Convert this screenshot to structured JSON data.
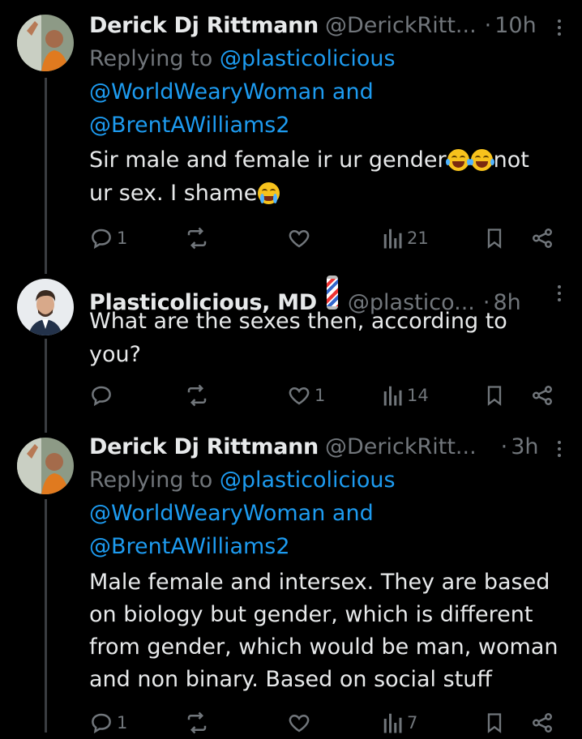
{
  "tweets": [
    {
      "name": "Derick Dj Rittmann",
      "handle": "@DerickRitt...",
      "time": "10h",
      "replying_prefix": "Replying to",
      "replying_1": "@plasticolicious",
      "replying_2": "@WorldWearyWoman",
      "replying_and": "and",
      "replying_3": "@BrentAWilliams2",
      "text_1": "Sir male and female ir ur gender",
      "text_2": "not",
      "text_3": "ur sex. I shame",
      "replies": "1",
      "reposts": "",
      "likes": "",
      "views": "21"
    },
    {
      "name": "Plasticolicious, MD",
      "handle": "@plastico...",
      "time": "8h",
      "text_1": "What are the sexes then, according to",
      "text_2": "you?",
      "replies": "",
      "reposts": "",
      "likes": "1",
      "views": "14"
    },
    {
      "name": "Derick Dj Rittmann",
      "handle": "@DerickRitt...",
      "time": "3h",
      "replying_prefix": "Replying to",
      "replying_1": "@plasticolicious",
      "replying_2": "@WorldWearyWoman",
      "replying_and": "and",
      "replying_3": "@BrentAWilliams2",
      "text_1": "Male female and intersex. They are based",
      "text_2": "on biology but gender, which is different",
      "text_3": "from gender, which would be man, woman",
      "text_4": "and non binary. Based on social stuff",
      "replies": "1",
      "reposts": "",
      "likes": "",
      "views": "7"
    }
  ],
  "separator": "·",
  "colors": {
    "background": "#000000",
    "text": "#e7e9ea",
    "muted": "#71767b",
    "link": "#1d9bf0"
  }
}
